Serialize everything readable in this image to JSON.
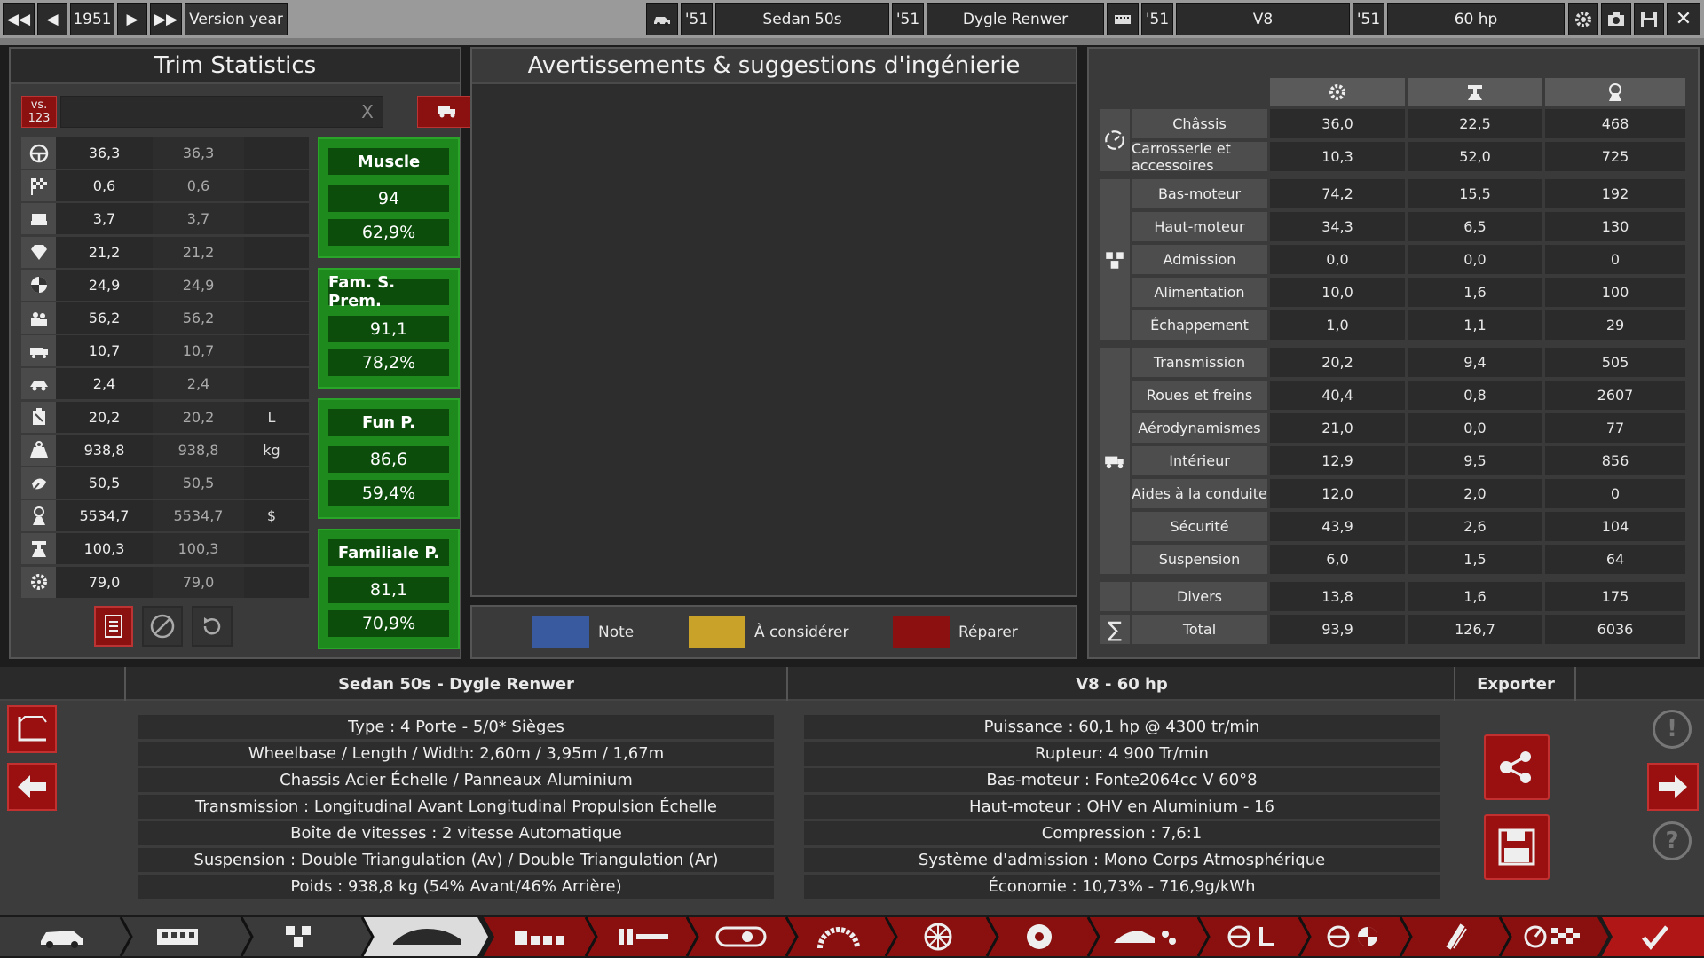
{
  "topbar": {
    "year": "1951",
    "version_label": "Version year",
    "model_year": "'51",
    "model_name": "Sedan 50s",
    "trim_year": "'51",
    "trim_name": "Dygle Renwer",
    "engine_year": "'51",
    "engine_name": "V8",
    "variant_year": "'51",
    "variant_name": "60 hp"
  },
  "trim_stats": {
    "title": "Trim Statistics",
    "vs_label": "vs.",
    "vs_number": "123",
    "search_placeholder": "",
    "clear_label": "X",
    "rows": [
      {
        "icon": "steering-wheel-icon",
        "v1": "36,3",
        "v2": "36,3",
        "unit": ""
      },
      {
        "icon": "racing-flag-icon",
        "v1": "0,6",
        "v2": "0,6",
        "unit": ""
      },
      {
        "icon": "seat-icon",
        "v1": "3,7",
        "v2": "3,7",
        "unit": ""
      },
      {
        "icon": "diamond-icon",
        "v1": "21,2",
        "v2": "21,2",
        "unit": ""
      },
      {
        "icon": "crash-test-icon",
        "v1": "24,9",
        "v2": "24,9",
        "unit": ""
      },
      {
        "icon": "passengers-icon",
        "v1": "56,2",
        "v2": "56,2",
        "unit": ""
      },
      {
        "icon": "utility-vehicle-icon",
        "v1": "10,7",
        "v2": "10,7",
        "unit": ""
      },
      {
        "icon": "offroad-car-icon",
        "v1": "2,4",
        "v2": "2,4",
        "unit": ""
      },
      {
        "icon": "fuel-canister-icon",
        "v1": "20,2",
        "v2": "20,2",
        "unit": "L"
      },
      {
        "icon": "weight-icon",
        "v1": "938,8",
        "v2": "938,8",
        "unit": "kg"
      },
      {
        "icon": "environment-icon",
        "v1": "50,5",
        "v2": "50,5",
        "unit": ""
      },
      {
        "icon": "price-icon",
        "v1": "5534,7",
        "v2": "5534,7",
        "unit": "$"
      },
      {
        "icon": "production-icon",
        "v1": "100,3",
        "v2": "100,3",
        "unit": ""
      },
      {
        "icon": "engineering-icon",
        "v1": "79,0",
        "v2": "79,0",
        "unit": ""
      }
    ],
    "cards": [
      {
        "name": "Muscle",
        "score": "94",
        "pct": "62,9%"
      },
      {
        "name": "Fam. S. Prem.",
        "score": "91,1",
        "pct": "78,2%"
      },
      {
        "name": "Fun P.",
        "score": "86,6",
        "pct": "59,4%"
      },
      {
        "name": "Familiale P.",
        "score": "81,1",
        "pct": "70,9%"
      }
    ]
  },
  "warnings": {
    "title": "Avertissements & suggestions d'ingénierie",
    "legend": [
      {
        "label": "Note",
        "color": "#3a5aa0"
      },
      {
        "label": "À considérer",
        "color": "#c9a22a"
      },
      {
        "label": "Réparer",
        "color": "#8c1010"
      }
    ]
  },
  "cost_table": {
    "groups": [
      {
        "icon": "chassis-gauge-icon",
        "rows": [
          {
            "name": "Châssis",
            "a": "36,0",
            "b": "22,5",
            "c": "468"
          },
          {
            "name": "Carrosserie et accessoires",
            "a": "10,3",
            "b": "52,0",
            "c": "725"
          }
        ]
      },
      {
        "icon": "engine-icon",
        "rows": [
          {
            "name": "Bas-moteur",
            "a": "74,2",
            "b": "15,5",
            "c": "192"
          },
          {
            "name": "Haut-moteur",
            "a": "34,3",
            "b": "6,5",
            "c": "130"
          },
          {
            "name": "Admission",
            "a": "0,0",
            "b": "0,0",
            "c": "0"
          },
          {
            "name": "Alimentation",
            "a": "10,0",
            "b": "1,6",
            "c": "100"
          },
          {
            "name": "Échappement",
            "a": "1,0",
            "b": "1,1",
            "c": "29"
          }
        ]
      },
      {
        "icon": "car-parts-icon",
        "rows": [
          {
            "name": "Transmission",
            "a": "20,2",
            "b": "9,4",
            "c": "505"
          },
          {
            "name": "Roues et freins",
            "a": "40,4",
            "b": "0,8",
            "c": "2607"
          },
          {
            "name": "Aérodynamismes",
            "a": "21,0",
            "b": "0,0",
            "c": "77"
          },
          {
            "name": "Intérieur",
            "a": "12,9",
            "b": "9,5",
            "c": "856"
          },
          {
            "name": "Aides à la conduite",
            "a": "12,0",
            "b": "2,0",
            "c": "0"
          },
          {
            "name": "Sécurité",
            "a": "43,9",
            "b": "2,6",
            "c": "104"
          },
          {
            "name": "Suspension",
            "a": "6,0",
            "b": "1,5",
            "c": "64"
          }
        ]
      }
    ],
    "divers": {
      "name": "Divers",
      "a": "13,8",
      "b": "1,6",
      "c": "175"
    },
    "total": {
      "symbol": "∑",
      "name": "Total",
      "a": "93,9",
      "b": "126,7",
      "c": "6036"
    }
  },
  "summary": {
    "car_title": "Sedan 50s - Dygle Renwer",
    "engine_title": "V8 - 60 hp",
    "export_label": "Exporter",
    "car_specs": [
      "Type : 4 Porte - 5/0* Sièges",
      "Wheelbase / Length / Width: 2,60m / 3,95m / 1,67m",
      "Chassis Acier Échelle / Panneaux Aluminium",
      "Transmission : Longitudinal Avant Longitudinal Propulsion Échelle",
      "Boîte de vitesses : 2 vitesse Automatique",
      "Suspension : Double Triangulation (Av) / Double Triangulation (Ar)",
      "Poids : 938,8 kg (54% Avant/46% Arrière)"
    ],
    "engine_specs": [
      "Puissance : 60,1 hp @ 4300 tr/min",
      "Rupteur: 4 900 Tr/min",
      "Bas-moteur : Fonte2064cc V 60°8",
      "Haut-moteur : OHV en Aluminium - 16",
      "Compression : 7,6:1",
      "Système d'admission : Mono Corps Atmosphérique",
      "Économie : 10,73% - 716,9g/kWh"
    ]
  }
}
